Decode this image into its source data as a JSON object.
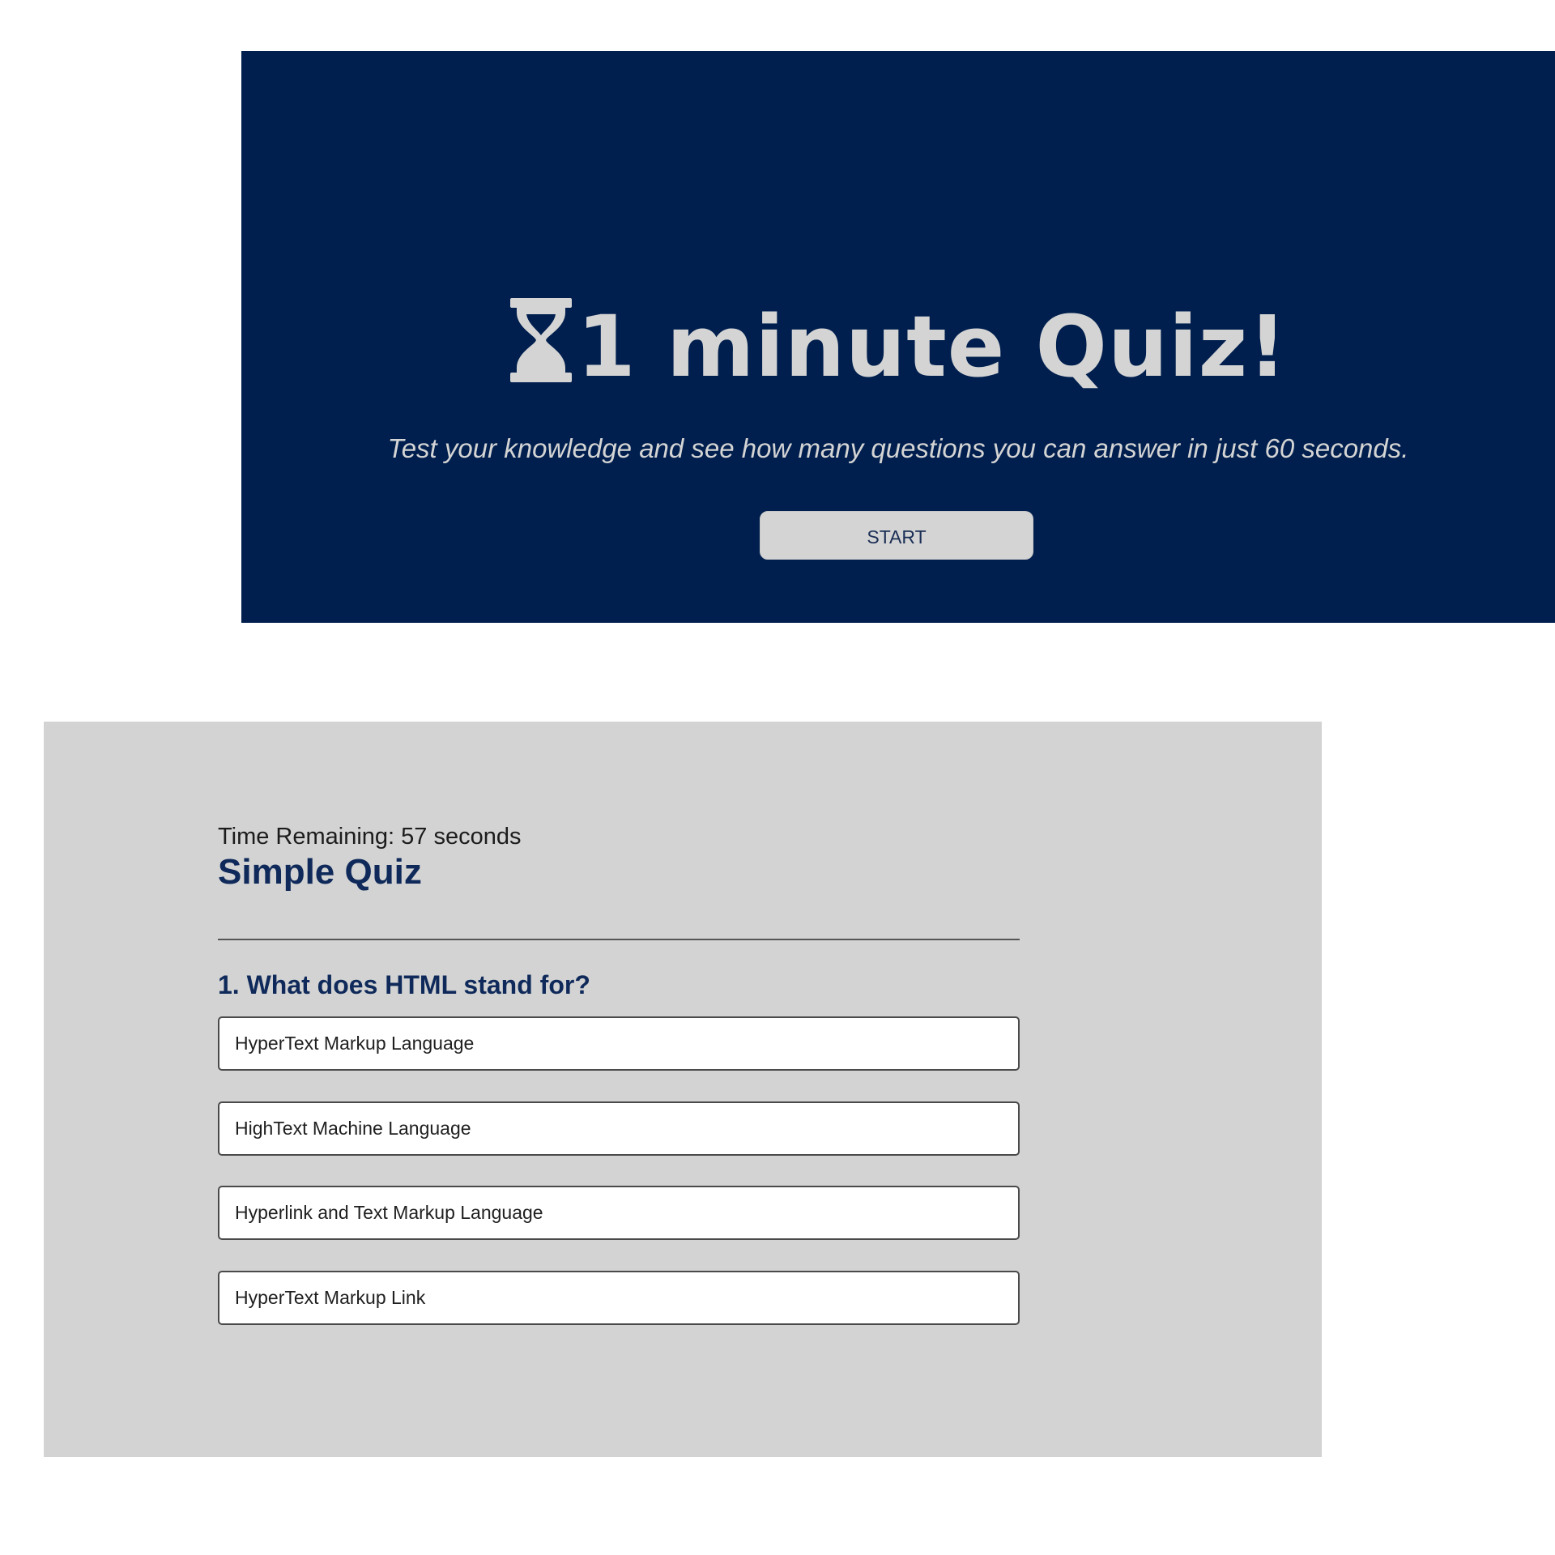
{
  "intro": {
    "icon": "hourglass-icon",
    "title": "1 minute Quiz!",
    "subtitle": "Test your knowledge and see how many questions you can answer in just 60 seconds.",
    "start_label": "START"
  },
  "quiz": {
    "timer_text": "Time Remaining: 57 seconds",
    "title": "Simple Quiz",
    "question": "1. What does HTML stand for?",
    "answers": [
      "HyperText Markup Language",
      "HighText Machine Language",
      "Hyperlink and Text Markup Language",
      "HyperText Markup Link"
    ]
  },
  "colors": {
    "hero_background": "#001f4e",
    "hero_text": "#d4d4d4",
    "quiz_background": "#d3d3d3",
    "accent_text": "#0f2a5a"
  }
}
